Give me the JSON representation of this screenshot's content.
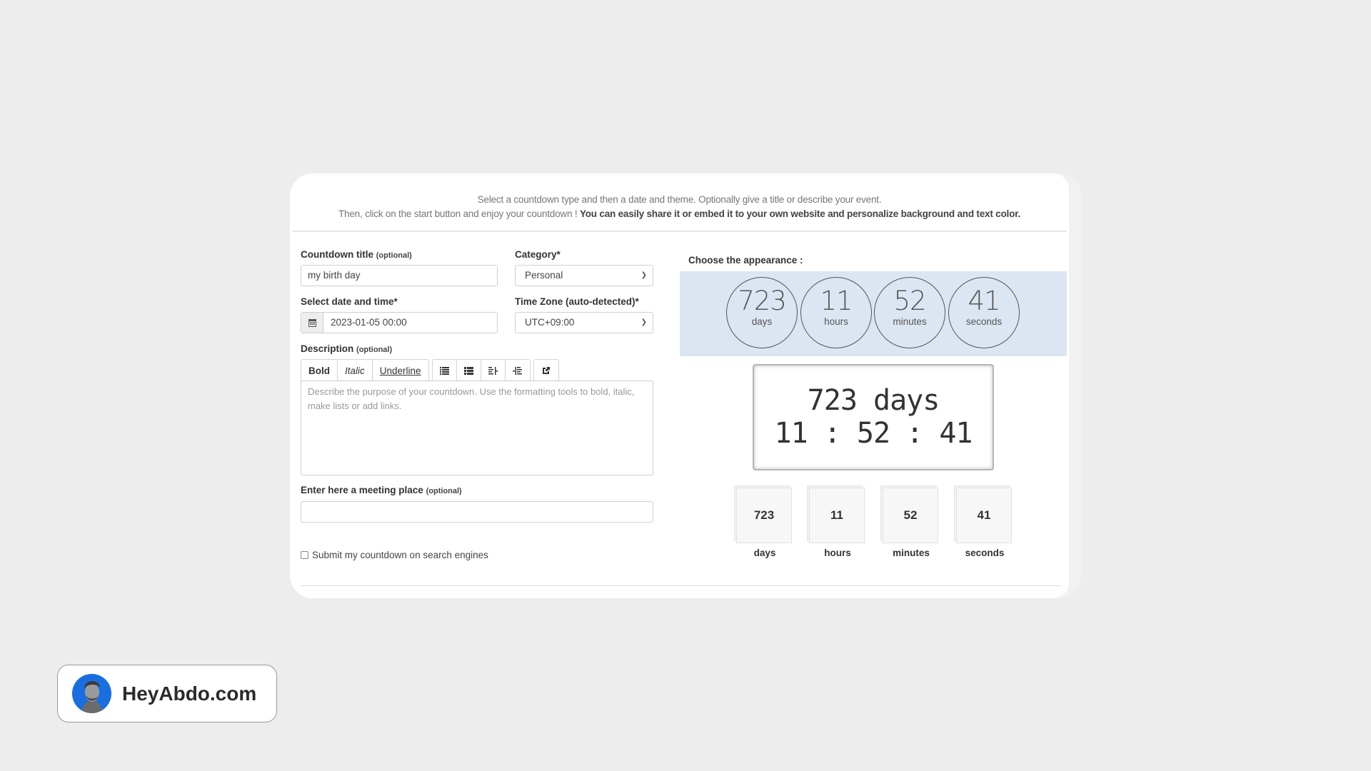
{
  "intro": {
    "line1": "Select a countdown type and then a date and theme. Optionally give a title or describe your event.",
    "line2_plain": "Then, click on the start button and enjoy your countdown ! ",
    "line2_bold": "You can easily share it or embed it to your own website and personalize background and text color."
  },
  "form": {
    "title_label": "Countdown title",
    "title_optional": "(optional)",
    "title_value": "my birth day",
    "category_label": "Category*",
    "category_value": "Personal",
    "date_label": "Select date and time*",
    "date_value": "2023-01-05 00:00",
    "date_icon": "calendar-icon",
    "timezone_label": "Time Zone (auto-detected)*",
    "timezone_value": "UTC+09:00",
    "description_label": "Description",
    "description_optional": "(optional)",
    "description_placeholder": "Describe the purpose of your countdown. Use the formatting tools to bold, italic, make lists or add links.",
    "toolbar": {
      "bold": "Bold",
      "italic": "Italic",
      "underline": "Underline",
      "icons": [
        "unordered-list-icon",
        "ordered-list-icon",
        "outdent-icon",
        "indent-icon",
        "link-icon"
      ]
    },
    "meeting_label": "Enter here a meeting place",
    "meeting_optional": "(optional)",
    "meeting_value": "",
    "submit_checkbox_label": "Submit my countdown on search engines",
    "submit_checkbox_checked": false
  },
  "appearance": {
    "label": "Choose the appearance :",
    "panel_color": "#dce6f2",
    "countdown": {
      "days": "723",
      "hours": "11",
      "minutes": "52",
      "seconds": "41"
    },
    "units": {
      "days": "days",
      "hours": "hours",
      "minutes": "minutes",
      "seconds": "seconds"
    },
    "digital_line1": "723 days",
    "digital_line2": "11 : 52 : 41"
  },
  "badge": {
    "text": "HeyAbdo.com",
    "avatar_color": "#1a6fe0"
  }
}
